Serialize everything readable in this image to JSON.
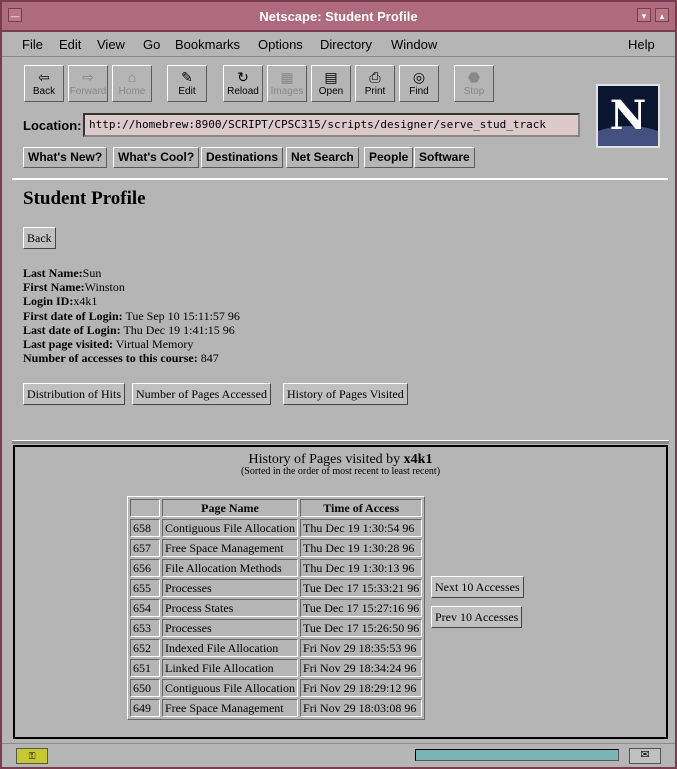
{
  "window": {
    "title": "Netscape: Student Profile"
  },
  "menu": [
    "File",
    "Edit",
    "View",
    "Go",
    "Bookmarks",
    "Options",
    "Directory",
    "Window",
    "Help"
  ],
  "toolbar": [
    {
      "label": "Back",
      "icon": "back-arrow-icon",
      "glyph": "⇦",
      "enabled": true
    },
    {
      "label": "Forward",
      "icon": "forward-arrow-icon",
      "glyph": "⇨",
      "enabled": false
    },
    {
      "label": "Home",
      "icon": "home-icon",
      "glyph": "⌂",
      "enabled": false
    },
    {
      "label": "Edit",
      "icon": "pencil-icon",
      "glyph": "✎",
      "enabled": true
    },
    {
      "label": "Reload",
      "icon": "reload-icon",
      "glyph": "↻",
      "enabled": true
    },
    {
      "label": "Images",
      "icon": "images-icon",
      "glyph": "▦",
      "enabled": false
    },
    {
      "label": "Open",
      "icon": "open-icon",
      "glyph": "▤",
      "enabled": true
    },
    {
      "label": "Print",
      "icon": "printer-icon",
      "glyph": "⎙",
      "enabled": true
    },
    {
      "label": "Find",
      "icon": "binoculars-icon",
      "glyph": "◎",
      "enabled": true
    },
    {
      "label": "Stop",
      "icon": "stop-icon",
      "glyph": "⬣",
      "enabled": false
    }
  ],
  "location": {
    "label": "Location:",
    "url": "http://homebrew:8900/SCRIPT/CPSC315/scripts/designer/serve_stud_track"
  },
  "directory_buttons": [
    "What's New?",
    "What's Cool?",
    "Destinations",
    "Net Search",
    "People",
    "Software"
  ],
  "profile": {
    "title": "Student Profile",
    "back_label": "Back",
    "fields": [
      {
        "label": "Last Name:",
        "value": "Sun"
      },
      {
        "label": "First Name:",
        "value": "Winston"
      },
      {
        "label": "Login ID:",
        "value": "x4k1"
      },
      {
        "label": "First date of Login:",
        "value": " Tue Sep 10 15:11:57 96"
      },
      {
        "label": "Last date of Login:",
        "value": " Thu Dec 19 1:41:15 96"
      },
      {
        "label": "Last page visited:",
        "value": " Virtual Memory"
      },
      {
        "label": "Number of accesses to this course:",
        "value": " 847"
      }
    ],
    "actions": [
      "Distribution of Hits",
      "Number of Pages Accessed",
      "History of Pages Visited"
    ]
  },
  "history": {
    "title_prefix": "History of Pages visited by ",
    "user": "x4k1",
    "subtitle": "(Sorted in the order of most recent to least recent)",
    "columns": [
      "",
      "Page Name",
      "Time of Access"
    ],
    "rows": [
      [
        "658",
        "Contiguous File Allocation",
        "Thu Dec 19 1:30:54 96"
      ],
      [
        "657",
        "Free Space Management",
        "Thu Dec 19 1:30:28 96"
      ],
      [
        "656",
        "File Allocation Methods",
        "Thu Dec 19 1:30:13 96"
      ],
      [
        "655",
        "Processes",
        "Tue Dec 17 15:33:21 96"
      ],
      [
        "654",
        "Process States",
        "Tue Dec 17 15:27:16 96"
      ],
      [
        "653",
        "Processes",
        "Tue Dec 17 15:26:50 96"
      ],
      [
        "652",
        "Indexed File Allocation",
        "Fri Nov 29 18:35:53 96"
      ],
      [
        "651",
        "Linked File Allocation",
        "Fri Nov 29 18:34:24 96"
      ],
      [
        "650",
        "Contiguous File Allocation",
        "Fri Nov 29 18:29:12 96"
      ],
      [
        "649",
        "Free Space Management",
        "Fri Nov 29 18:03:08 96"
      ]
    ],
    "next_label": "Next 10 Accesses",
    "prev_label": "Prev 10 Accesses"
  },
  "logo": {
    "letter": "N"
  }
}
